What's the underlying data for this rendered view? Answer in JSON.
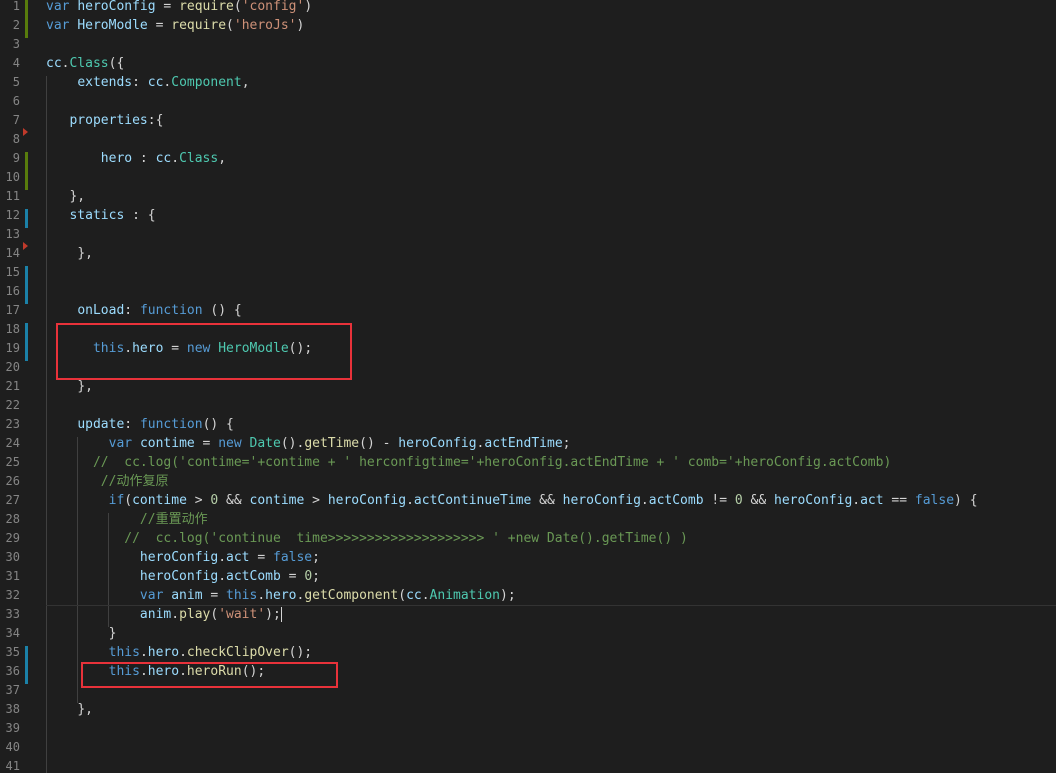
{
  "colors": {
    "background": "#1e1e1e",
    "line_number": "#858585",
    "keyword": "#569cd6",
    "variable": "#9cdcfe",
    "function": "#dcdcaa",
    "string": "#ce9178",
    "number": "#b5cea8",
    "comment": "#6a9955",
    "type": "#4ec9b0",
    "plain": "#d4d4d4",
    "highlight_box": "#e8323a",
    "gutter_added": "#587c0c",
    "gutter_modified": "#1b81a8"
  },
  "lines": [
    {
      "n": "1",
      "tokens": [
        [
          "kw",
          "var "
        ],
        [
          "var",
          "heroConfig"
        ],
        [
          "plain",
          " = "
        ],
        [
          "fn",
          "require"
        ],
        [
          "plain",
          "("
        ],
        [
          "str",
          "'config'"
        ],
        [
          "plain",
          ")"
        ]
      ]
    },
    {
      "n": "2",
      "tokens": [
        [
          "kw",
          "var "
        ],
        [
          "var",
          "HeroModle"
        ],
        [
          "plain",
          " = "
        ],
        [
          "fn",
          "require"
        ],
        [
          "plain",
          "("
        ],
        [
          "str",
          "'heroJs'"
        ],
        [
          "plain",
          ")"
        ]
      ]
    },
    {
      "n": "3",
      "tokens": []
    },
    {
      "n": "4",
      "tokens": [
        [
          "var",
          "cc"
        ],
        [
          "plain",
          "."
        ],
        [
          "type",
          "Class"
        ],
        [
          "plain",
          "({"
        ]
      ]
    },
    {
      "n": "5",
      "tokens": [
        [
          "plain",
          "    "
        ],
        [
          "var",
          "extends"
        ],
        [
          "plain",
          ": "
        ],
        [
          "var",
          "cc"
        ],
        [
          "plain",
          "."
        ],
        [
          "type",
          "Component"
        ],
        [
          "plain",
          ","
        ]
      ]
    },
    {
      "n": "6",
      "tokens": []
    },
    {
      "n": "7",
      "tokens": [
        [
          "plain",
          "   "
        ],
        [
          "var",
          "properties"
        ],
        [
          "plain",
          ":{"
        ]
      ]
    },
    {
      "n": "8",
      "tokens": []
    },
    {
      "n": "9",
      "tokens": [
        [
          "plain",
          "       "
        ],
        [
          "var",
          "hero"
        ],
        [
          "plain",
          " : "
        ],
        [
          "var",
          "cc"
        ],
        [
          "plain",
          "."
        ],
        [
          "type",
          "Class"
        ],
        [
          "plain",
          ","
        ]
      ]
    },
    {
      "n": "10",
      "tokens": []
    },
    {
      "n": "11",
      "tokens": [
        [
          "plain",
          "   "
        ],
        [
          "plain",
          "},"
        ]
      ]
    },
    {
      "n": "12",
      "tokens": [
        [
          "plain",
          "   "
        ],
        [
          "var",
          "statics"
        ],
        [
          "plain",
          " : {"
        ]
      ]
    },
    {
      "n": "13",
      "tokens": []
    },
    {
      "n": "14",
      "tokens": [
        [
          "plain",
          "    "
        ],
        [
          "plain",
          "},"
        ]
      ]
    },
    {
      "n": "15",
      "tokens": []
    },
    {
      "n": "16",
      "tokens": []
    },
    {
      "n": "17",
      "tokens": [
        [
          "plain",
          "    "
        ],
        [
          "var",
          "onLoad"
        ],
        [
          "plain",
          ": "
        ],
        [
          "kw",
          "function"
        ],
        [
          "plain",
          " () {"
        ]
      ]
    },
    {
      "n": "18",
      "tokens": []
    },
    {
      "n": "19",
      "tokens": [
        [
          "plain",
          "      "
        ],
        [
          "kw",
          "this"
        ],
        [
          "plain",
          "."
        ],
        [
          "var",
          "hero"
        ],
        [
          "plain",
          " = "
        ],
        [
          "kw",
          "new "
        ],
        [
          "type",
          "HeroModle"
        ],
        [
          "plain",
          "();"
        ]
      ]
    },
    {
      "n": "20",
      "tokens": []
    },
    {
      "n": "21",
      "tokens": [
        [
          "plain",
          "    "
        ],
        [
          "plain",
          "},"
        ]
      ]
    },
    {
      "n": "22",
      "tokens": []
    },
    {
      "n": "23",
      "tokens": [
        [
          "plain",
          "    "
        ],
        [
          "var",
          "update"
        ],
        [
          "plain",
          ": "
        ],
        [
          "kw",
          "function"
        ],
        [
          "plain",
          "() {"
        ]
      ]
    },
    {
      "n": "24",
      "tokens": [
        [
          "plain",
          "        "
        ],
        [
          "kw",
          "var "
        ],
        [
          "var",
          "contime"
        ],
        [
          "plain",
          " = "
        ],
        [
          "kw",
          "new "
        ],
        [
          "type",
          "Date"
        ],
        [
          "plain",
          "()."
        ],
        [
          "fn",
          "getTime"
        ],
        [
          "plain",
          "() - "
        ],
        [
          "var",
          "heroConfig"
        ],
        [
          "plain",
          "."
        ],
        [
          "var",
          "actEndTime"
        ],
        [
          "plain",
          ";"
        ]
      ]
    },
    {
      "n": "25",
      "tokens": [
        [
          "plain",
          "      "
        ],
        [
          "cmt",
          "//  cc.log('contime='+contime + ' herconfigtime='+heroConfig.actEndTime + ' comb='+heroConfig.actComb)"
        ]
      ]
    },
    {
      "n": "26",
      "tokens": [
        [
          "plain",
          "       "
        ],
        [
          "cmt",
          "//动作复原"
        ]
      ]
    },
    {
      "n": "27",
      "tokens": [
        [
          "plain",
          "        "
        ],
        [
          "kw",
          "if"
        ],
        [
          "plain",
          "("
        ],
        [
          "var",
          "contime"
        ],
        [
          "plain",
          " > "
        ],
        [
          "num",
          "0"
        ],
        [
          "plain",
          " && "
        ],
        [
          "var",
          "contime"
        ],
        [
          "plain",
          " > "
        ],
        [
          "var",
          "heroConfig"
        ],
        [
          "plain",
          "."
        ],
        [
          "var",
          "actContinueTime"
        ],
        [
          "plain",
          " && "
        ],
        [
          "var",
          "heroConfig"
        ],
        [
          "plain",
          "."
        ],
        [
          "var",
          "actComb"
        ],
        [
          "plain",
          " != "
        ],
        [
          "num",
          "0"
        ],
        [
          "plain",
          " && "
        ],
        [
          "var",
          "heroConfig"
        ],
        [
          "plain",
          "."
        ],
        [
          "var",
          "act"
        ],
        [
          "plain",
          " == "
        ],
        [
          "kw",
          "false"
        ],
        [
          "plain",
          ") {"
        ]
      ]
    },
    {
      "n": "28",
      "tokens": [
        [
          "plain",
          "            "
        ],
        [
          "cmt",
          "//重置动作"
        ]
      ]
    },
    {
      "n": "29",
      "tokens": [
        [
          "plain",
          "          "
        ],
        [
          "cmt",
          "//  cc.log('continue  time>>>>>>>>>>>>>>>>>>>> ' +new Date().getTime() )"
        ]
      ]
    },
    {
      "n": "30",
      "tokens": [
        [
          "plain",
          "            "
        ],
        [
          "var",
          "heroConfig"
        ],
        [
          "plain",
          "."
        ],
        [
          "var",
          "act"
        ],
        [
          "plain",
          " = "
        ],
        [
          "kw",
          "false"
        ],
        [
          "plain",
          ";"
        ]
      ]
    },
    {
      "n": "31",
      "tokens": [
        [
          "plain",
          "            "
        ],
        [
          "var",
          "heroConfig"
        ],
        [
          "plain",
          "."
        ],
        [
          "var",
          "actComb"
        ],
        [
          "plain",
          " = "
        ],
        [
          "num",
          "0"
        ],
        [
          "plain",
          ";"
        ]
      ]
    },
    {
      "n": "32",
      "tokens": [
        [
          "plain",
          "            "
        ],
        [
          "kw",
          "var "
        ],
        [
          "var",
          "anim"
        ],
        [
          "plain",
          " = "
        ],
        [
          "kw",
          "this"
        ],
        [
          "plain",
          "."
        ],
        [
          "var",
          "hero"
        ],
        [
          "plain",
          "."
        ],
        [
          "fn",
          "getComponent"
        ],
        [
          "plain",
          "("
        ],
        [
          "var",
          "cc"
        ],
        [
          "plain",
          "."
        ],
        [
          "type",
          "Animation"
        ],
        [
          "plain",
          ");"
        ]
      ]
    },
    {
      "n": "33",
      "tokens": [
        [
          "plain",
          "            "
        ],
        [
          "var",
          "anim"
        ],
        [
          "plain",
          "."
        ],
        [
          "fn",
          "play"
        ],
        [
          "plain",
          "("
        ],
        [
          "str",
          "'wait'"
        ],
        [
          "plain",
          ");"
        ]
      ],
      "cursor": true
    },
    {
      "n": "34",
      "tokens": [
        [
          "plain",
          "        "
        ],
        [
          "plain",
          "}"
        ]
      ]
    },
    {
      "n": "35",
      "tokens": [
        [
          "plain",
          "        "
        ],
        [
          "kw",
          "this"
        ],
        [
          "plain",
          "."
        ],
        [
          "var",
          "hero"
        ],
        [
          "plain",
          "."
        ],
        [
          "fn",
          "checkClipOver"
        ],
        [
          "plain",
          "();"
        ]
      ]
    },
    {
      "n": "36",
      "tokens": [
        [
          "plain",
          "        "
        ],
        [
          "kw",
          "this"
        ],
        [
          "plain",
          "."
        ],
        [
          "var",
          "hero"
        ],
        [
          "plain",
          "."
        ],
        [
          "fn",
          "heroRun"
        ],
        [
          "plain",
          "();"
        ]
      ]
    },
    {
      "n": "37",
      "tokens": []
    },
    {
      "n": "38",
      "tokens": [
        [
          "plain",
          "    "
        ],
        [
          "plain",
          "},"
        ]
      ]
    },
    {
      "n": "39",
      "tokens": []
    },
    {
      "n": "40",
      "tokens": []
    },
    {
      "n": "41",
      "tokens": []
    }
  ]
}
